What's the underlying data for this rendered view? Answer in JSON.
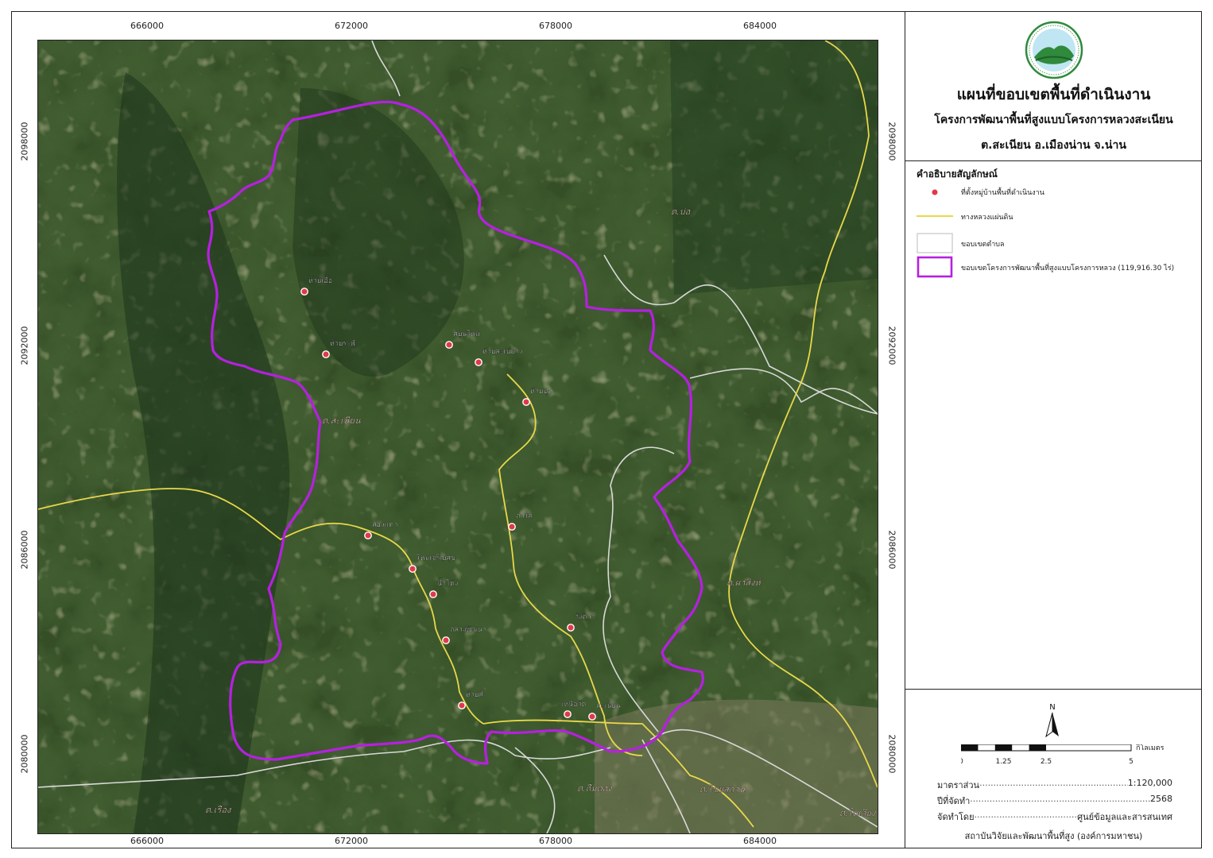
{
  "map": {
    "x_ticks": [
      "666000",
      "672000",
      "678000",
      "684000"
    ],
    "y_ticks": [
      "2098000",
      "2092000",
      "2086000",
      "2080000"
    ],
    "colors": {
      "boundary_project": "#b620e0",
      "national_road": "#e8d84a",
      "subdistrict_boundary": "#d9d9d9",
      "village_marker": "#e0394a",
      "imagery_dark": "#1f3a1e",
      "imagery_mid": "#3d5a2c",
      "imagery_light": "#6e7a45"
    },
    "villages": [
      "ห้วยเอื้อ",
      "ห้วยระพี",
      "สบูนใหม่",
      "ห้วยละเบ้ยาง",
      "ห้วยปุก",
      "สองแคว",
      "ใหม่เจริญสุข",
      "น้ำโค้ง",
      "กาใส",
      "กลางพัฒนา",
      "วังคาว",
      "ห้วยสี่",
      "เหนือวัด",
      "สะเนียน"
    ],
    "subdistricts": [
      "ต.บ่อ",
      "ต.สะเนียน",
      "ต.ผาสิงห์",
      "ต.ถืมตอง",
      "ต.ไชยสถาน",
      "ต.เรือง",
      "ต.ในเวียง"
    ]
  },
  "panel": {
    "title": "แผนที่ขอบเขตพื้นที่ดำเนินงาน",
    "subtitle": "โครงการพัฒนาพื้นที่สูงแบบโครงการหลวงสะเนียน",
    "location": "ต.สะเนียน อ.เมืองน่าน จ.น่าน",
    "legend_title": "คำอธิบายสัญลักษณ์",
    "legend": [
      {
        "label": "ที่ตั้งหมู่บ้านพื้นที่ดำเนินงาน",
        "symbol": "village-marker"
      },
      {
        "label": "ทางหลวงแผ่นดิน",
        "symbol": "road-line"
      },
      {
        "label": "ขอบเขตตำบล",
        "symbol": "subdistrict-box"
      },
      {
        "label": "ขอบเขตโครงการพัฒนาพื้นที่สูงแบบโครงการหลวง (119,916.30 ไร่)",
        "symbol": "project-box"
      }
    ],
    "north_label": "N",
    "scale": {
      "labels": [
        "0",
        "1.25",
        "2.5",
        "5"
      ],
      "unit": "กิโลเมตร"
    },
    "info": [
      {
        "label": "มาตราส่วน",
        "value": "1:120,000"
      },
      {
        "label": "ปีที่จัดทำ",
        "value": "2568"
      },
      {
        "label": "จัดทำโดย",
        "value": "ศูนย์ข้อมูลและสารสนเทศ"
      }
    ],
    "institute": "สถาบันวิจัยและพัฒนาพื้นที่สูง (องค์การมหาชน)"
  }
}
